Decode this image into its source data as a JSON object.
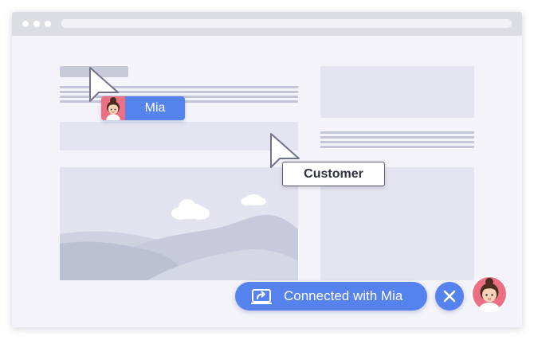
{
  "app": {
    "accent_color": "#5682ee",
    "window_background": "#f3f3f9"
  },
  "agent_cursor": {
    "name": "Mia",
    "icon": "pointer-cursor-icon",
    "avatar_icon": "agent-avatar-icon"
  },
  "customer_cursor": {
    "label": "Customer",
    "icon": "pointer-cursor-icon"
  },
  "session": {
    "status_label": "Connected with Mia",
    "share_icon": "screen-share-icon",
    "close_icon": "close-icon",
    "agent_avatar_icon": "agent-avatar-icon"
  }
}
